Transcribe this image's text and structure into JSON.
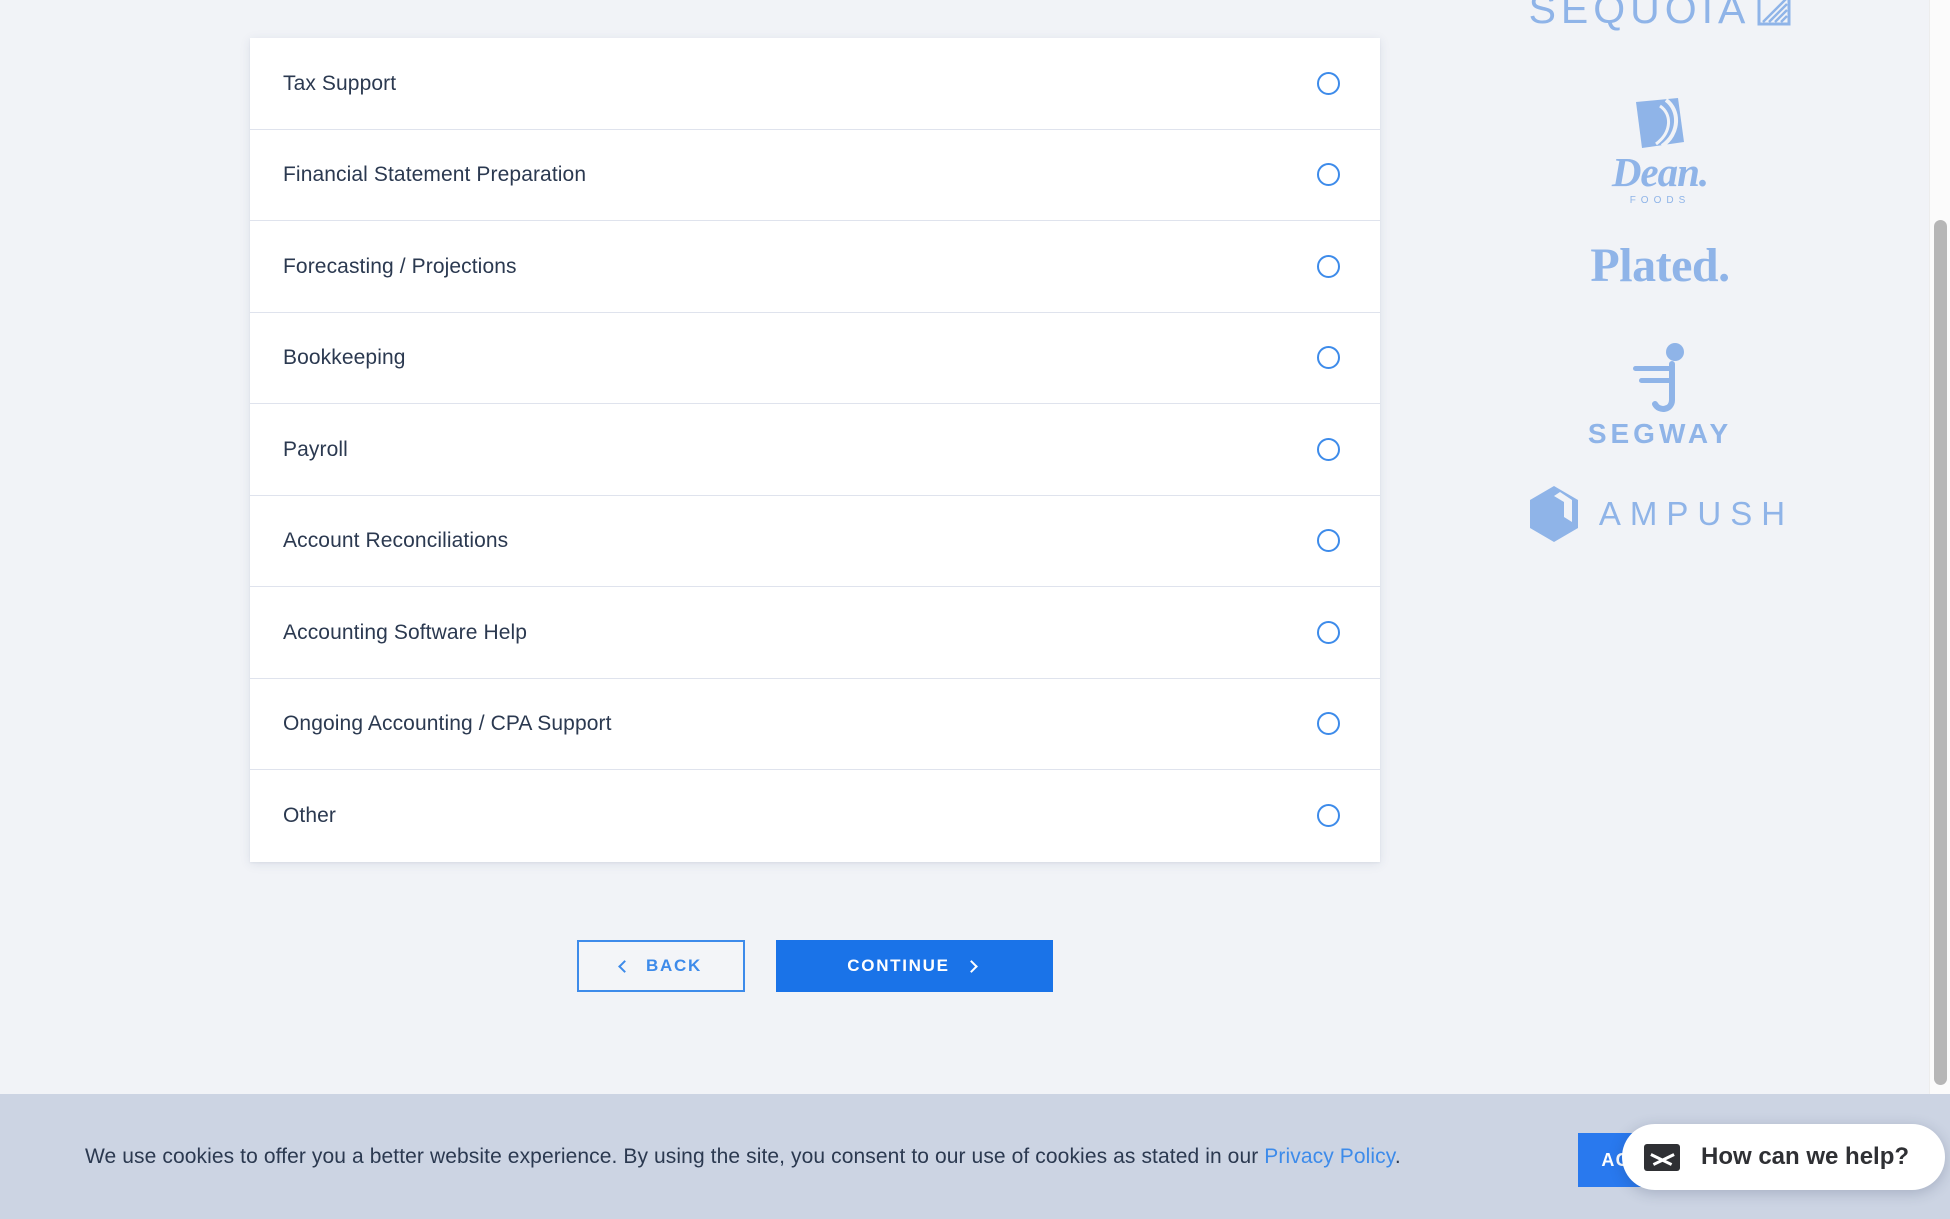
{
  "page": {
    "background_color": "#f1f3f7",
    "accent_blue": "#1a73e8",
    "link_blue": "#3d8bea",
    "text_navy": "#2b3950",
    "logo_blue": "#8fb4e8"
  },
  "options_card": {
    "options": [
      {
        "label": "Tax Support",
        "selected": false
      },
      {
        "label": "Financial Statement Preparation",
        "selected": false
      },
      {
        "label": "Forecasting / Projections",
        "selected": false
      },
      {
        "label": "Bookkeeping",
        "selected": false
      },
      {
        "label": "Payroll",
        "selected": false
      },
      {
        "label": "Account Reconciliations",
        "selected": false
      },
      {
        "label": "Accounting Software Help",
        "selected": false
      },
      {
        "label": "Ongoing Accounting / CPA Support",
        "selected": false
      },
      {
        "label": "Other",
        "selected": false
      }
    ]
  },
  "nav": {
    "back_label": "BACK",
    "continue_label": "CONTINUE"
  },
  "logos": {
    "sequoia": {
      "name": "SEQUOIA",
      "icon": "sequoia-mark-icon"
    },
    "dean": {
      "name": "Dean.",
      "sub": "FOODS",
      "icon": "dean-foods-mark-icon"
    },
    "plated": {
      "name": "Plated."
    },
    "segway": {
      "name": "SEGWAY",
      "icon": "segway-mark-icon"
    },
    "ampush": {
      "name": "AMPUSH",
      "icon": "ampush-hexagon-icon"
    }
  },
  "cookie_banner": {
    "text_before_link": "We use cookies to offer you a better website experience. By using the site, you consent to our use of cookies as stated in our ",
    "link_label": "Privacy Policy",
    "text_after_link": ".",
    "accept_label": "ACCEPT"
  },
  "chat_widget": {
    "label": "How can we help?",
    "icon": "envelope-icon"
  }
}
